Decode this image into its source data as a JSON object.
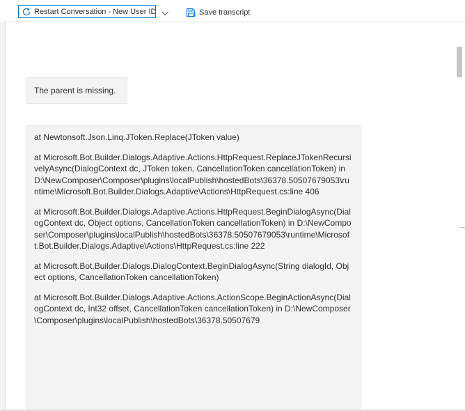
{
  "toolbar": {
    "restart_label": "Restart Conversation - New User ID",
    "save_label": "Save transcript"
  },
  "messages": [
    {
      "text": "The parent is missing."
    },
    {
      "lines": [
        "at Newtonsoft.Json.Linq.JToken.Replace(JToken value)",
        "at Microsoft.Bot.Builder.Dialogs.Adaptive.Actions.HttpRequest.ReplaceJTokenRecursivelyAsync(DialogContext dc, JToken token, CancellationToken cancellationToken) in D:\\NewComposer\\Composer\\plugins\\localPublish\\hostedBots\\36378.50507679053\\runtime\\Microsoft.Bot.Builder.Dialogs.Adaptive\\Actions\\HttpRequest.cs:line 406",
        "at Microsoft.Bot.Builder.Dialogs.Adaptive.Actions.HttpRequest.BeginDialogAsync(DialogContext dc, Object options, CancellationToken cancellationToken) in D:\\NewComposer\\Composer\\plugins\\localPublish\\hostedBots\\36378.50507679053\\runtime\\Microsoft.Bot.Builder.Dialogs.Adaptive\\Actions\\HttpRequest.cs:line 222",
        "at Microsoft.Bot.Builder.Dialogs.DialogContext.BeginDialogAsync(String dialogId, Object options, CancellationToken cancellationToken)",
        "at Microsoft.Bot.Builder.Dialogs.Adaptive.Actions.ActionScope.BeginActionAsync(DialogContext dc, Int32 offset, CancellationToken cancellationToken) in D:\\NewComposer\\Composer\\plugins\\localPublish\\hostedBots\\36378.50507679"
      ]
    }
  ]
}
